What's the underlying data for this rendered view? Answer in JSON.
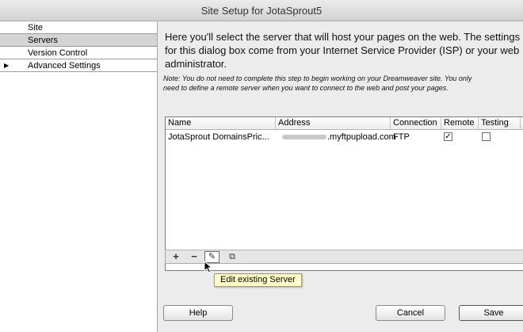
{
  "window": {
    "title": "Site Setup for JotaSprout5"
  },
  "sidebar": {
    "items": [
      {
        "label": "Site",
        "selected": false,
        "expandable": false
      },
      {
        "label": "Servers",
        "selected": true,
        "expandable": false
      },
      {
        "label": "Version Control",
        "selected": false,
        "expandable": false
      },
      {
        "label": "Advanced Settings",
        "selected": false,
        "expandable": true
      }
    ]
  },
  "main": {
    "intro": "Here you'll select the server that will host your pages on the web. The settings for this dialog box come from your Internet Service Provider (ISP) or your web administrator.",
    "note_line1": "Note: You do not need to complete this step to begin working on your Dreamweaver site. You only",
    "note_line2": "need to define a remote server when you want to connect to the web and post your pages."
  },
  "servers_table": {
    "columns": [
      "Name",
      "Address",
      "Connection",
      "Remote",
      "Testing"
    ],
    "rows": [
      {
        "name": "JotaSprout DomainsPric...",
        "address": ".myftpupload.com",
        "connection": "FTP",
        "remote": true,
        "testing": false
      }
    ]
  },
  "toolbar": {
    "add_glyph": "+",
    "remove_glyph": "−",
    "edit_glyph": "✎",
    "duplicate_glyph": "⧉",
    "tooltip": "Edit existing Server"
  },
  "buttons": {
    "help": "Help",
    "cancel": "Cancel",
    "save": "Save"
  },
  "check_glyph": "✓"
}
